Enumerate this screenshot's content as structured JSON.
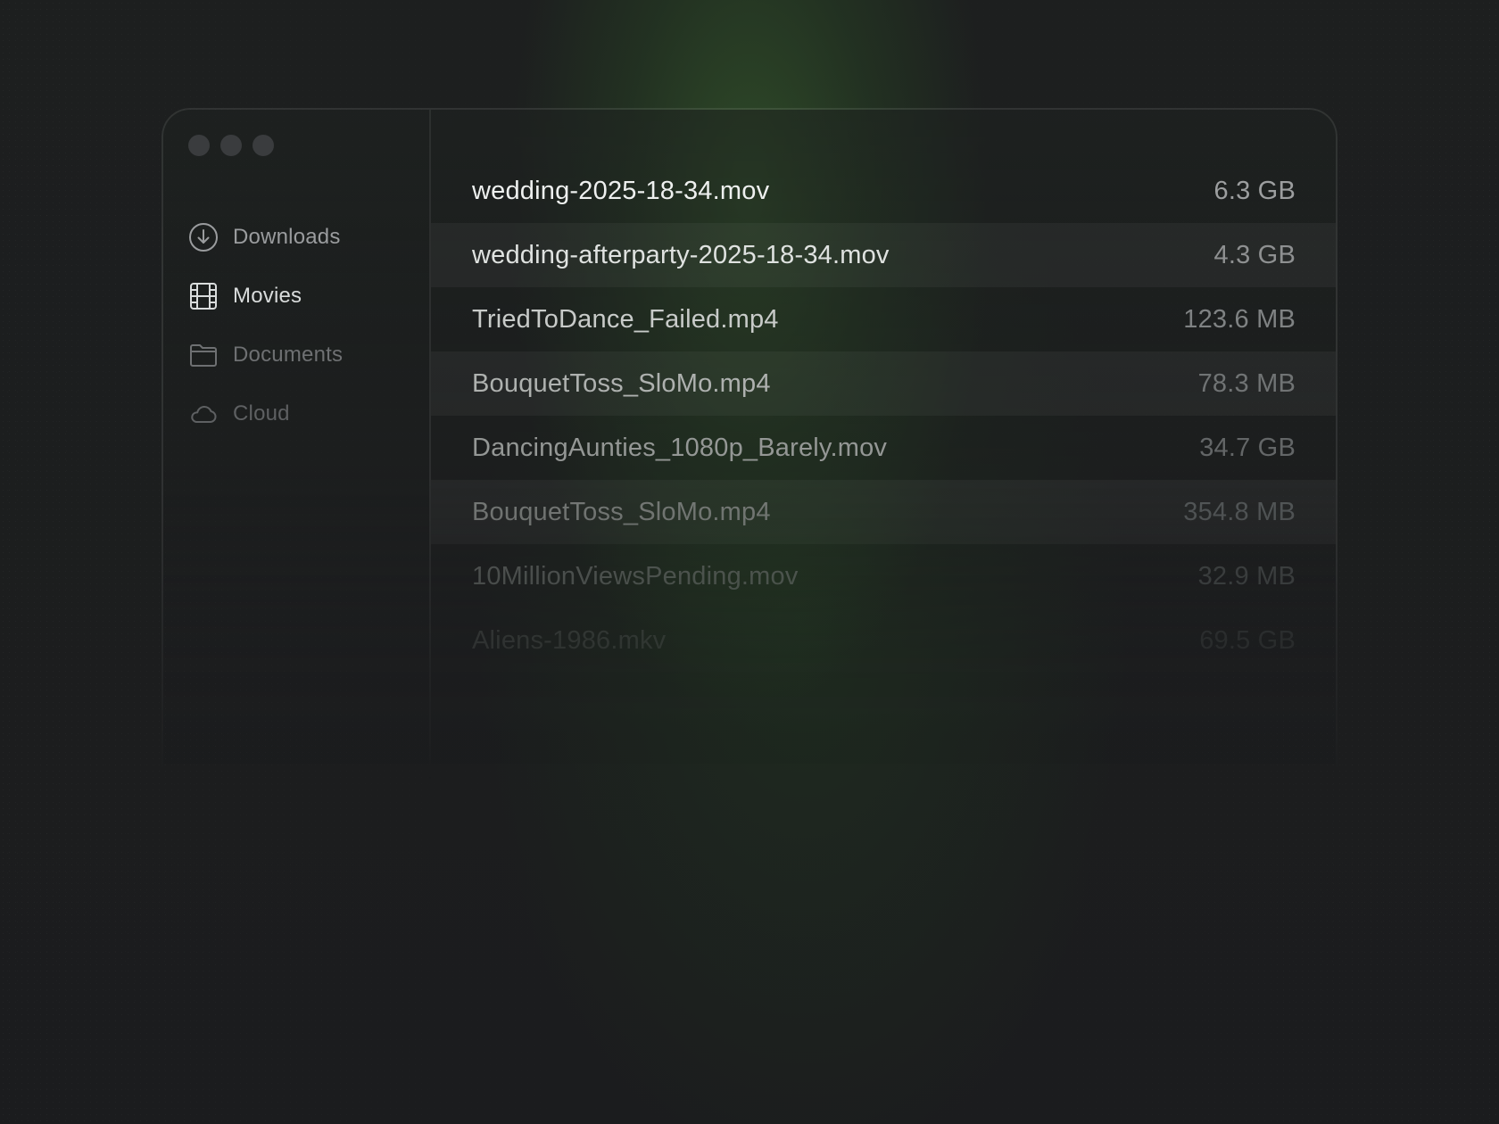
{
  "sidebar": {
    "items": [
      {
        "label": "Downloads",
        "icon": "download-circle-icon"
      },
      {
        "label": "Movies",
        "icon": "film-icon"
      },
      {
        "label": "Documents",
        "icon": "folder-icon"
      },
      {
        "label": "Cloud",
        "icon": "cloud-icon"
      }
    ],
    "selected": "Movies"
  },
  "files": [
    {
      "name": "wedding-2025-18-34.mov",
      "size": "6.3 GB"
    },
    {
      "name": "wedding-afterparty-2025-18-34.mov",
      "size": "4.3 GB"
    },
    {
      "name": "TriedToDance_Failed.mp4",
      "size": "123.6 MB"
    },
    {
      "name": "BouquetToss_SloMo.mp4",
      "size": "78.3 MB"
    },
    {
      "name": "DancingAunties_1080p_Barely.mov",
      "size": "34.7 GB"
    },
    {
      "name": "BouquetToss_SloMo.mp4",
      "size": "354.8 MB"
    },
    {
      "name": "10MillionViewsPending.mov",
      "size": "32.9 MB"
    },
    {
      "name": "Aliens-1986.mkv",
      "size": "69.5 GB"
    }
  ],
  "colors": {
    "background": "#1c1d1f",
    "accent_glow": "#3e7030",
    "traffic_dot": "#3a3c3e"
  }
}
